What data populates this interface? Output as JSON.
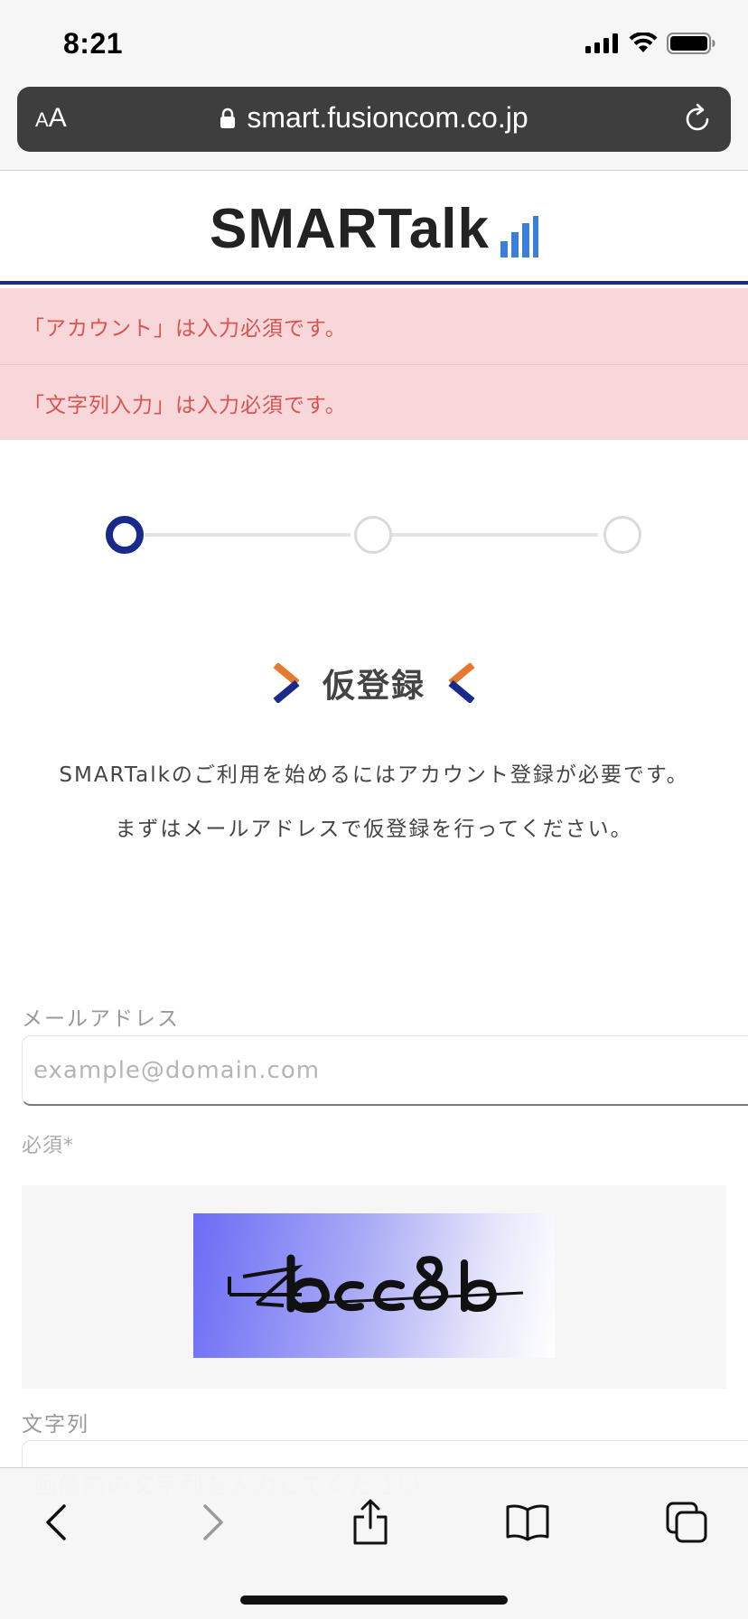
{
  "status_bar": {
    "time": "8:21"
  },
  "browser": {
    "aa_small": "A",
    "aa_big": "A",
    "url": "smart.fusioncom.co.jp"
  },
  "site": {
    "logo_text": "SMARTalk",
    "brand_color": "#1a2a8c",
    "logo_bar_color": "#3b7fd9"
  },
  "alerts": [
    {
      "text": "「アカウント」は入力必須です。"
    },
    {
      "text": "「文字列入力」は入力必須です。"
    }
  ],
  "stepper": {
    "current_step": 1,
    "total_steps": 3
  },
  "page": {
    "title": "仮登録",
    "intro_line1": "SMARTalkのご利用を始めるにはアカウント登録が必要です。",
    "intro_line2": "まずはメールアドレスで仮登録を行ってください。"
  },
  "form": {
    "email_label": "メールアドレス",
    "email_placeholder": "example@domain.com",
    "email_value": "",
    "required_note": "必須*",
    "captcha_text": "4bcc8b",
    "chars_label": "文字列",
    "chars_placeholder": "画像内の文字列を入力してください",
    "chars_value": ""
  },
  "toolbar": {
    "icons": [
      "back-icon",
      "forward-icon",
      "share-icon",
      "bookmarks-icon",
      "tabs-icon"
    ]
  }
}
